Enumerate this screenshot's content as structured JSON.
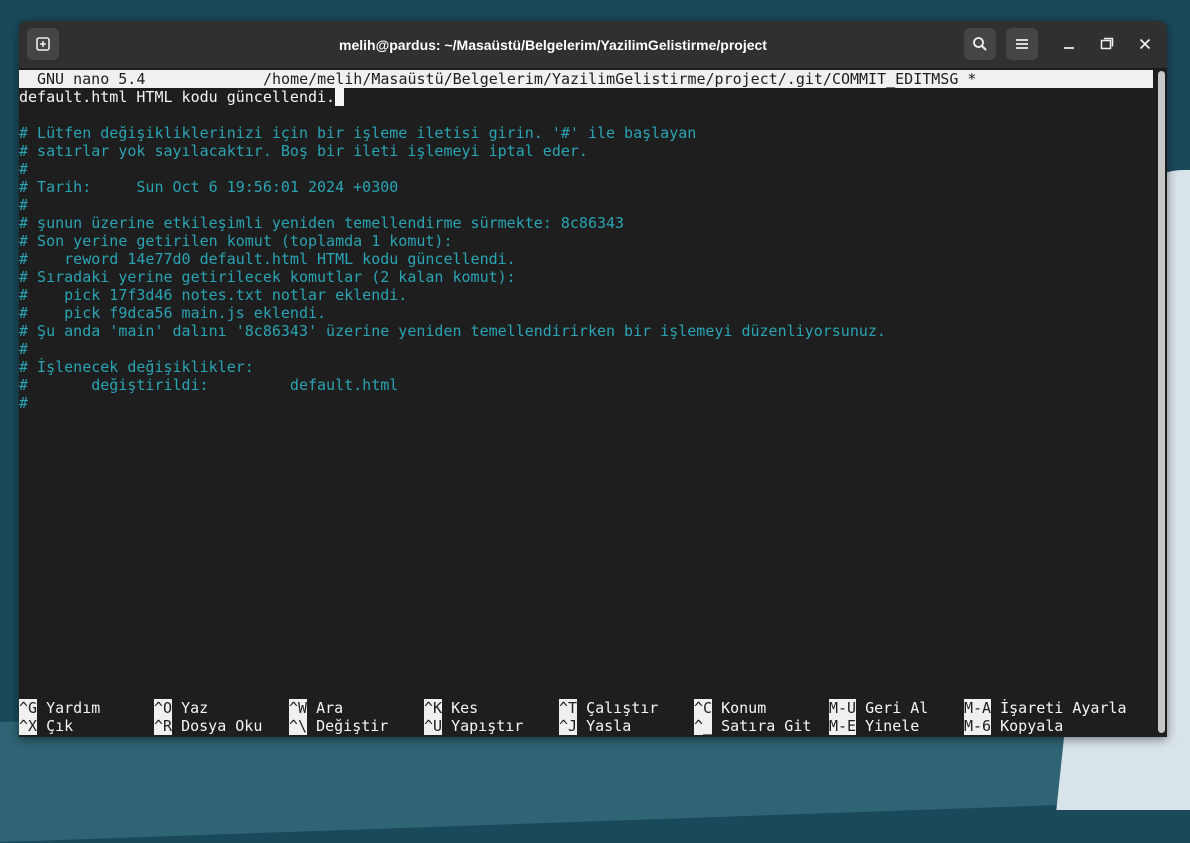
{
  "window": {
    "title": "melih@pardus: ~/Masaüstü/Belgelerim/YazilimGelistirme/project"
  },
  "icons": {
    "new_tab": "new-tab-icon",
    "search": "search-icon",
    "menu": "hamburger-menu-icon",
    "minimize": "minimize-icon",
    "maximize": "maximize-icon",
    "close": "close-icon"
  },
  "nano": {
    "version": "GNU nano 5.4",
    "file_path": "/home/melih/Masaüstü/Belgelerim/YazilimGelistirme/project/.git/COMMIT_EDITMSG *",
    "first_line": "default.html HTML kodu güncellendi.",
    "comment_lines": [
      "",
      "# Lütfen değişikliklerinizi için bir işleme iletisi girin. '#' ile başlayan",
      "# satırlar yok sayılacaktır. Boş bir ileti işlemeyi iptal eder.",
      "#",
      "# Tarih:     Sun Oct 6 19:56:01 2024 +0300",
      "#",
      "# şunun üzerine etkileşimli yeniden temellendirme sürmekte: 8c86343",
      "# Son yerine getirilen komut (toplamda 1 komut):",
      "#    reword 14e77d0 default.html HTML kodu güncellendi.",
      "# Sıradaki yerine getirilecek komutlar (2 kalan komut):",
      "#    pick 17f3d46 notes.txt notlar eklendi.",
      "#    pick f9dca56 main.js eklendi.",
      "# Şu anda 'main' dalını '8c86343' üzerine yeniden temellendirirken bir işlemeyi düzenliyorsunuz.",
      "#",
      "# İşlenecek değişiklikler:",
      "#       değiştirildi:         default.html",
      "#"
    ],
    "shortcuts_row1": [
      {
        "key": "^G",
        "label": "Yardım"
      },
      {
        "key": "^O",
        "label": "Yaz"
      },
      {
        "key": "^W",
        "label": "Ara"
      },
      {
        "key": "^K",
        "label": "Kes"
      },
      {
        "key": "^T",
        "label": "Çalıştır"
      },
      {
        "key": "^C",
        "label": "Konum"
      },
      {
        "key": "M-U",
        "label": "Geri Al"
      },
      {
        "key": "M-A",
        "label": "İşareti Ayarla"
      }
    ],
    "shortcuts_row2": [
      {
        "key": "^X",
        "label": "Çık"
      },
      {
        "key": "^R",
        "label": "Dosya Oku"
      },
      {
        "key": "^\\",
        "label": "Değiştir"
      },
      {
        "key": "^U",
        "label": "Yapıştır"
      },
      {
        "key": "^J",
        "label": "Yasla"
      },
      {
        "key": "^_",
        "label": "Satıra Git"
      },
      {
        "key": "M-E",
        "label": "Yinele"
      },
      {
        "key": "M-6",
        "label": "Kopyala"
      }
    ]
  }
}
